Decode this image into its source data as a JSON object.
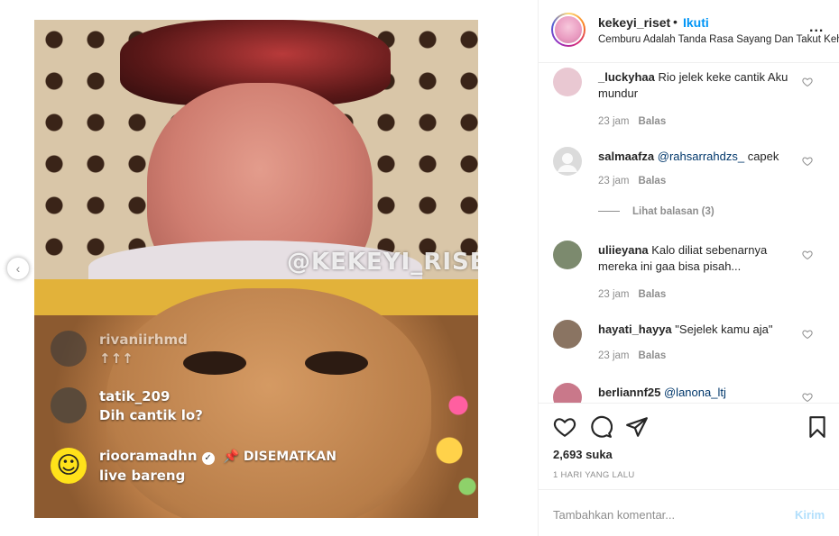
{
  "post": {
    "username": "kekeyi_riset",
    "follow_separator": "•",
    "follow_label": "Ikuti",
    "caption": "Cemburu Adalah Tanda Rasa Sayang Dan Takut Kehilangan",
    "more_icon": "more-horizontal-icon",
    "more_label": "..."
  },
  "media": {
    "watermark": "@KEKEYI_RISET",
    "live_comments": [
      {
        "user": "rivaniirhmd",
        "message": "↑↑↑"
      },
      {
        "user": "tatik_209",
        "message": "Dih cantik lo?"
      },
      {
        "user": "riooramadhn",
        "pinned_label": "📌 DISEMATKAN",
        "message": "live bareng",
        "avatar_glyph": "☺"
      }
    ]
  },
  "comments": [
    {
      "user": "_luckyhaa",
      "text": "Rio jelek keke cantik Aku mundur",
      "time": "23 jam",
      "reply": "Balas",
      "avatar_color": "#e9c8d2"
    },
    {
      "user": "salmaafza",
      "mention": "@rahsarrahdzs_",
      "text": "capek",
      "time": "23 jam",
      "reply": "Balas",
      "avatar_color": "#dbdbdb",
      "view_replies": "Lihat balasan (3)"
    },
    {
      "user": "uliieyana",
      "text": "Kalo diliat sebenarnya mereka ini gaa bisa pisah...",
      "time": "23 jam",
      "reply": "Balas",
      "avatar_color": "#7c8a6e"
    },
    {
      "user": "hayati_hayya",
      "text": "\"Sejelek kamu aja\"",
      "time": "23 jam",
      "reply": "Balas",
      "avatar_color": "#8a7462"
    },
    {
      "user": "berliannf25",
      "mention": "@lanona_ltj",
      "text": "",
      "avatar_color": "#c9788a"
    }
  ],
  "actions": {
    "like_icon": "heart-icon",
    "comment_icon": "comment-bubble-icon",
    "share_icon": "paper-plane-icon",
    "save_icon": "bookmark-icon",
    "likes": "2,693 suka",
    "time_ago": "1 HARI YANG LALU"
  },
  "comment_box": {
    "placeholder": "Tambahkan komentar...",
    "post_label": "Kirim"
  },
  "colors": {
    "accent": "#0095f6",
    "muted": "#8e8e8e",
    "border": "#efefef",
    "post_disabled": "#b2dffc"
  }
}
